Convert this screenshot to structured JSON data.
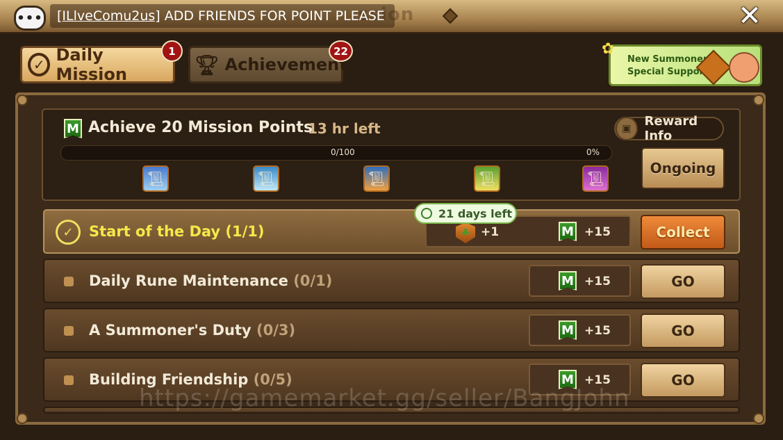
{
  "chat": {
    "icon": "chat-bubble-icon",
    "username": "[ILlveComu2us]",
    "message": "ADD FRIENDS FOR POINT PLEASE"
  },
  "header": {
    "title_fragment": "ssion"
  },
  "tabs": [
    {
      "label": "Daily Mission",
      "badge": "1",
      "active": true
    },
    {
      "label": "Achievement",
      "badge": "22",
      "active": false
    }
  ],
  "promo": {
    "line1": "New Summoner",
    "line2": "Special Support"
  },
  "summary": {
    "title": "Achieve 20 Mission Points",
    "time_left": "13 hr left",
    "progress_text": "0/100",
    "progress_pct": "0%",
    "progress_fraction": 0,
    "reward_info_label": "Reward Info",
    "status_button": "Ongoing",
    "reward_icons": [
      "scroll-reward-icon",
      "scroll-reward-icon",
      "scroll-reward-icon",
      "scroll-reward-icon",
      "scroll-reward-icon"
    ]
  },
  "missions": [
    {
      "name": "Start of the Day",
      "progress": "(1/1)",
      "reward_item": "+1",
      "points": "+15",
      "button": "Collect",
      "tooltip": "21 days left"
    },
    {
      "name": "Daily Rune Maintenance",
      "progress": "(0/1)",
      "points": "+15",
      "button": "GO"
    },
    {
      "name": "A Summoner's Duty",
      "progress": "(0/3)",
      "points": "+15",
      "button": "GO"
    },
    {
      "name": "Building Friendship",
      "progress": "(0/5)",
      "points": "+15",
      "button": "GO"
    }
  ],
  "m_icon_letter": "M",
  "watermark": "https://gamemarket.gg/seller/BangJohn",
  "colors": {
    "accent_yellow": "#f5e84a",
    "collect_orange": "#f08a3a",
    "progress_green": "#7bb33a",
    "badge_red": "#a11414"
  }
}
